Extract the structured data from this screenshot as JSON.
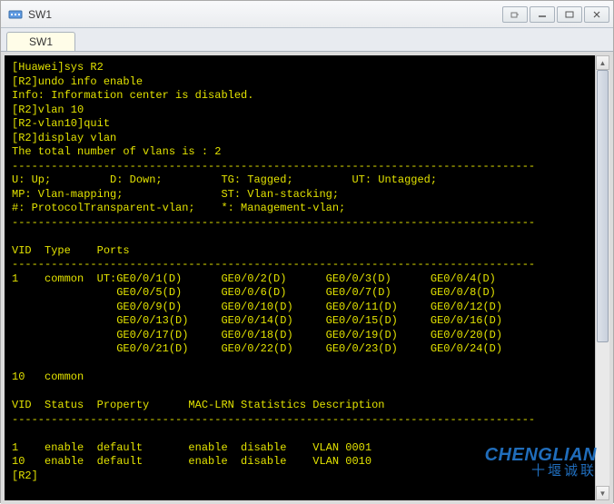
{
  "window": {
    "title": "SW1",
    "icon": "switch-icon"
  },
  "tabs": [
    {
      "label": "SW1"
    }
  ],
  "terminal": {
    "lines": [
      "[Huawei]sys R2",
      "[R2]undo info enable",
      "Info: Information center is disabled.",
      "[R2]vlan 10",
      "[R2-vlan10]quit",
      "[R2]display vlan",
      "The total number of vlans is : 2",
      "--------------------------------------------------------------------------------",
      "U: Up;         D: Down;         TG: Tagged;         UT: Untagged;",
      "MP: Vlan-mapping;               ST: Vlan-stacking;",
      "#: ProtocolTransparent-vlan;    *: Management-vlan;",
      "--------------------------------------------------------------------------------",
      "",
      "VID  Type    Ports",
      "--------------------------------------------------------------------------------",
      "1    common  UT:GE0/0/1(D)      GE0/0/2(D)      GE0/0/3(D)      GE0/0/4(D)",
      "                GE0/0/5(D)      GE0/0/6(D)      GE0/0/7(D)      GE0/0/8(D)",
      "                GE0/0/9(D)      GE0/0/10(D)     GE0/0/11(D)     GE0/0/12(D)",
      "                GE0/0/13(D)     GE0/0/14(D)     GE0/0/15(D)     GE0/0/16(D)",
      "                GE0/0/17(D)     GE0/0/18(D)     GE0/0/19(D)     GE0/0/20(D)",
      "                GE0/0/21(D)     GE0/0/22(D)     GE0/0/23(D)     GE0/0/24(D)",
      "",
      "10   common",
      "",
      "VID  Status  Property      MAC-LRN Statistics Description",
      "--------------------------------------------------------------------------------",
      "",
      "1    enable  default       enable  disable    VLAN 0001",
      "10   enable  default       enable  disable    VLAN 0010",
      "[R2]"
    ]
  },
  "vlan_table": {
    "total_vlans": 2,
    "legend": {
      "U": "Up",
      "D": "Down",
      "TG": "Tagged",
      "UT": "Untagged",
      "MP": "Vlan-mapping",
      "ST": "Vlan-stacking",
      "#": "ProtocolTransparent-vlan",
      "*": "Management-vlan"
    },
    "ports_columns": [
      "VID",
      "Type",
      "Ports"
    ],
    "ports_rows": [
      {
        "vid": 1,
        "type": "common",
        "port_group": "UT",
        "ports": [
          "GE0/0/1(D)",
          "GE0/0/2(D)",
          "GE0/0/3(D)",
          "GE0/0/4(D)",
          "GE0/0/5(D)",
          "GE0/0/6(D)",
          "GE0/0/7(D)",
          "GE0/0/8(D)",
          "GE0/0/9(D)",
          "GE0/0/10(D)",
          "GE0/0/11(D)",
          "GE0/0/12(D)",
          "GE0/0/13(D)",
          "GE0/0/14(D)",
          "GE0/0/15(D)",
          "GE0/0/16(D)",
          "GE0/0/17(D)",
          "GE0/0/18(D)",
          "GE0/0/19(D)",
          "GE0/0/20(D)",
          "GE0/0/21(D)",
          "GE0/0/22(D)",
          "GE0/0/23(D)",
          "GE0/0/24(D)"
        ]
      },
      {
        "vid": 10,
        "type": "common",
        "port_group": null,
        "ports": []
      }
    ],
    "status_columns": [
      "VID",
      "Status",
      "Property",
      "MAC-LRN",
      "Statistics",
      "Description"
    ],
    "status_rows": [
      {
        "vid": 1,
        "status": "enable",
        "property": "default",
        "mac_lrn": "enable",
        "statistics": "disable",
        "description": "VLAN 0001"
      },
      {
        "vid": 10,
        "status": "enable",
        "property": "default",
        "mac_lrn": "enable",
        "statistics": "disable",
        "description": "VLAN 0010"
      }
    ]
  },
  "watermark": {
    "en": "CHENGLIAN",
    "zh": "十堰诚联"
  }
}
